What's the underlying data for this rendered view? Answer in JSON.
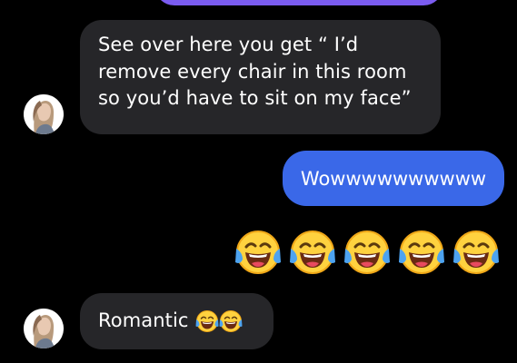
{
  "conversation": {
    "messages": [
      {
        "sender": "contact",
        "lines": [
          "See over here you get “ I’d",
          "remove every chair in this room",
          "so you’d have to sit on my face”"
        ]
      },
      {
        "sender": "me",
        "text": "Wowwwwwwwwww"
      },
      {
        "sender": "me",
        "emoji_name": "face-with-tears-of-joy",
        "emoji_count": 5
      },
      {
        "sender": "contact",
        "text": "Romantic",
        "emoji_name": "face-with-tears-of-joy",
        "emoji_count": 2
      }
    ]
  },
  "colors": {
    "background": "#000000",
    "incoming_bubble": "#262629",
    "outgoing_bubble": "#3a68e8",
    "previous_bubble": "#7b5cf0"
  }
}
